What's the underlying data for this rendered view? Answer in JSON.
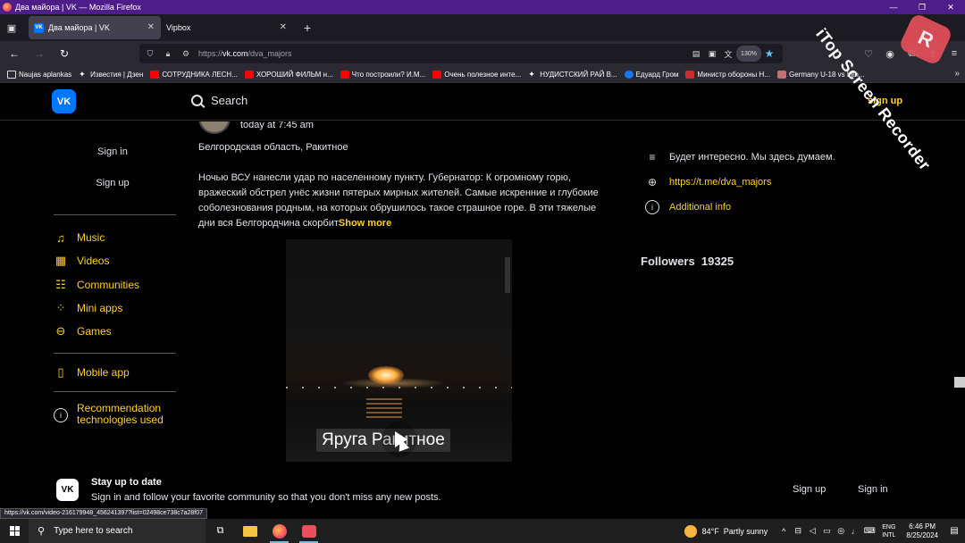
{
  "window": {
    "title": "Два майора | VK — Mozilla Firefox",
    "controls": [
      "—",
      "❐",
      "✕"
    ]
  },
  "tabs": [
    {
      "label": "Два майора | VK",
      "favicon": "VK"
    },
    {
      "label": "Vipbox"
    }
  ],
  "urlbar": {
    "url_prefix": "https://",
    "url_host": "vk.com",
    "url_path": "/dva_majors",
    "zoom": "130%"
  },
  "bookmarks": [
    {
      "label": "Naujas aplankas",
      "icon": "folder"
    },
    {
      "label": "Известия | Дзен",
      "icon": "star4"
    },
    {
      "label": "СОТРУДНИКА ЛЕСН...",
      "icon": "yt"
    },
    {
      "label": "ХОРОШИЙ ФИЛЬМ н...",
      "icon": "yt"
    },
    {
      "label": "Что построили? И.М...",
      "icon": "yt"
    },
    {
      "label": "Очень полезное инте...",
      "icon": "yt"
    },
    {
      "label": "НУДИСТСКИЙ РАЙ В...",
      "icon": "star4"
    },
    {
      "label": "Едуард Гром",
      "icon": "fb"
    },
    {
      "label": "Министр обороны Н...",
      "icon": "red"
    },
    {
      "label": "Germany U-18 vs Lith...",
      "icon": "pink"
    }
  ],
  "vk": {
    "logo": "VK",
    "search_label": "Search",
    "signup_top": "sign up",
    "sidebar": {
      "sign_in": "Sign in",
      "sign_up": "Sign up",
      "items": [
        {
          "label": "Music",
          "icon": "music-icon"
        },
        {
          "label": "Videos",
          "icon": "videos-icon"
        },
        {
          "label": "Communities",
          "icon": "communities-icon"
        },
        {
          "label": "Mini apps",
          "icon": "mini-apps-icon"
        },
        {
          "label": "Games",
          "icon": "games-icon"
        }
      ],
      "mobile_app": "Mobile app",
      "recommendation_line1": "Recommendation",
      "recommendation_line2": "technologies used"
    },
    "post": {
      "time": "today at 7:45 am",
      "location": "Белгородская область, Ракитное",
      "text": "Ночью ВСУ нанесли удар по населенному пункту. Губернатор: К огромному горю, вражеский обстрел унёс жизни пятерых мирных жителей. Самые искренние и глубокие соболезнования родным, на которых обрушилось такое страшное горе. В эти тяжелые дни вся Белгородчина скорбит",
      "show_more": "Show more",
      "video_caption": "Яруга Ракитное"
    },
    "info": {
      "description": "Будет интересно. Мы здесь думаем.",
      "link": "https://t.me/dva_majors",
      "additional": "Additional info",
      "followers_label": "Followers",
      "followers_count": "19325"
    },
    "banner": {
      "title": "Stay up to date",
      "subtitle": "Sign in and follow your favorite community so that you don't miss any new posts.",
      "sign_up": "Sign up",
      "sign_in": "Sign in"
    }
  },
  "status_url": "https://vk.com/video-216179948_456241397?list=02498ce738c7a28f07",
  "taskbar": {
    "search_placeholder": "Type here to search",
    "weather_temp": "84°F",
    "weather_text": "Partly sunny",
    "lang_line1": "ENG",
    "lang_line2": "INTL",
    "time": "6:46 PM",
    "date": "8/25/2024"
  },
  "watermark": "iTop Screen Recorder"
}
